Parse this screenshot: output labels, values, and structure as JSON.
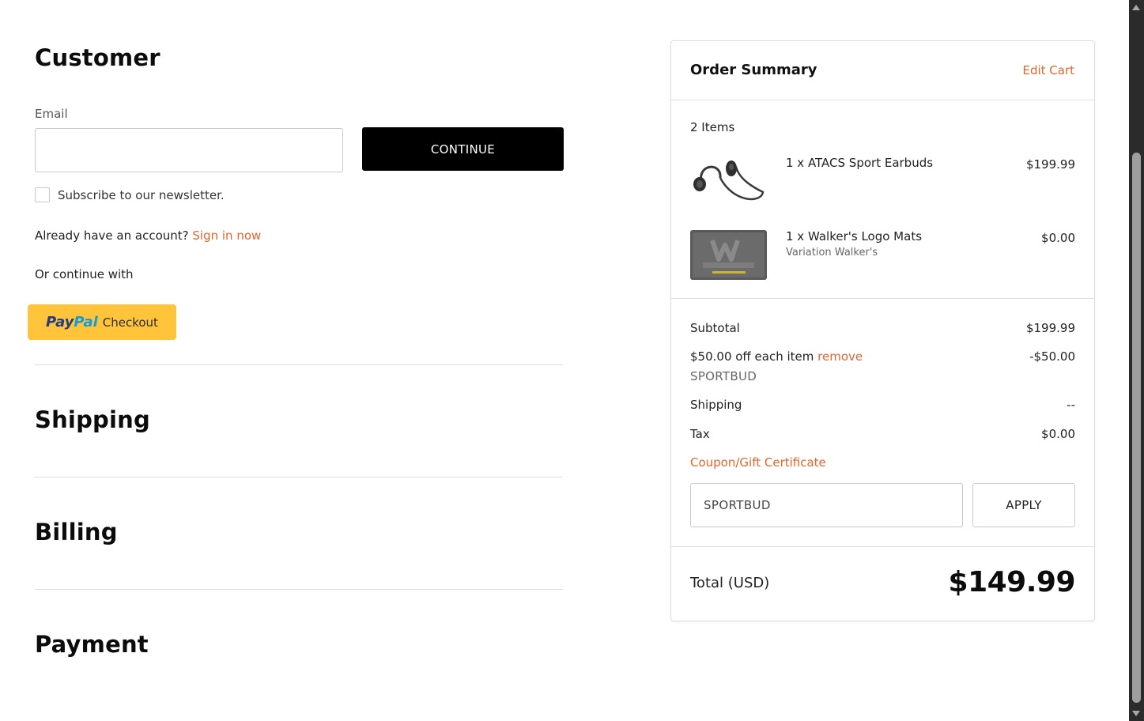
{
  "customer": {
    "title": "Customer",
    "email_label": "Email",
    "email_value": "",
    "continue_label": "CONTINUE",
    "newsletter_label": "Subscribe to our newsletter.",
    "account_prompt": "Already have an account?",
    "sign_in_label": "Sign in now",
    "continue_with": "Or continue with",
    "paypal": {
      "pay": "Pay",
      "pal": "Pal",
      "checkout": "Checkout"
    }
  },
  "sections": {
    "shipping": "Shipping",
    "billing": "Billing",
    "payment": "Payment"
  },
  "summary": {
    "title": "Order Summary",
    "edit_cart": "Edit Cart",
    "items_count": "2 Items",
    "items": [
      {
        "name": "1 x ATACS Sport Earbuds",
        "variant": "",
        "price": "$199.99",
        "image": "earbuds-image"
      },
      {
        "name": "1 x Walker's Logo Mats",
        "variant": "Variation Walker's",
        "price": "$0.00",
        "image": "logo-mat-image"
      }
    ],
    "subtotal_label": "Subtotal",
    "subtotal_value": "$199.99",
    "discount_label": "$50.00 off each item",
    "discount_remove": "remove",
    "discount_code": "SPORTBUD",
    "discount_value": "-$50.00",
    "shipping_label": "Shipping",
    "shipping_value": "--",
    "tax_label": "Tax",
    "tax_value": "$0.00",
    "coupon_link": "Coupon/Gift Certificate",
    "coupon_value": "SPORTBUD",
    "apply_label": "APPLY",
    "total_label": "Total (USD)",
    "total_value": "$149.99"
  },
  "colors": {
    "accent": "#e2662f",
    "button_dark": "#000000",
    "paypal_yellow": "#ffc439"
  }
}
